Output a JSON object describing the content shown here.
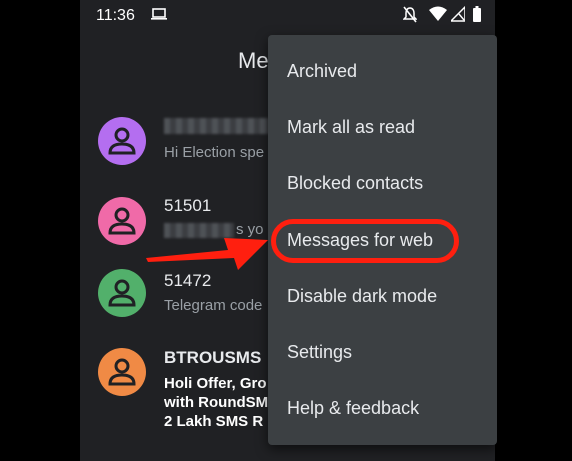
{
  "statusbar": {
    "time": "11:36"
  },
  "header": {
    "title": "Me"
  },
  "conversations": [
    {
      "name": "",
      "snippet": "Hi Election spe",
      "avatar_color": "#b46ef0"
    },
    {
      "name": "51501",
      "snippet": "s yo",
      "avatar_color": "#f06aa8"
    },
    {
      "name": "51472",
      "snippet": "Telegram code",
      "avatar_color": "#52b06b"
    },
    {
      "name": "BTROUSMS",
      "snippet_lines": [
        "Holi Offer, Gro",
        "with RoundSM",
        "2 Lakh SMS R"
      ],
      "avatar_color": "#f08a45"
    }
  ],
  "menu": {
    "items": [
      {
        "label": "Archived"
      },
      {
        "label": "Mark all as read"
      },
      {
        "label": "Blocked contacts"
      },
      {
        "label": "Messages for web"
      },
      {
        "label": "Disable dark mode"
      },
      {
        "label": "Settings"
      },
      {
        "label": "Help & feedback"
      }
    ]
  },
  "annotation": {
    "highlight_color": "#ff1f0f",
    "highlighted_item": "Messages for web"
  }
}
